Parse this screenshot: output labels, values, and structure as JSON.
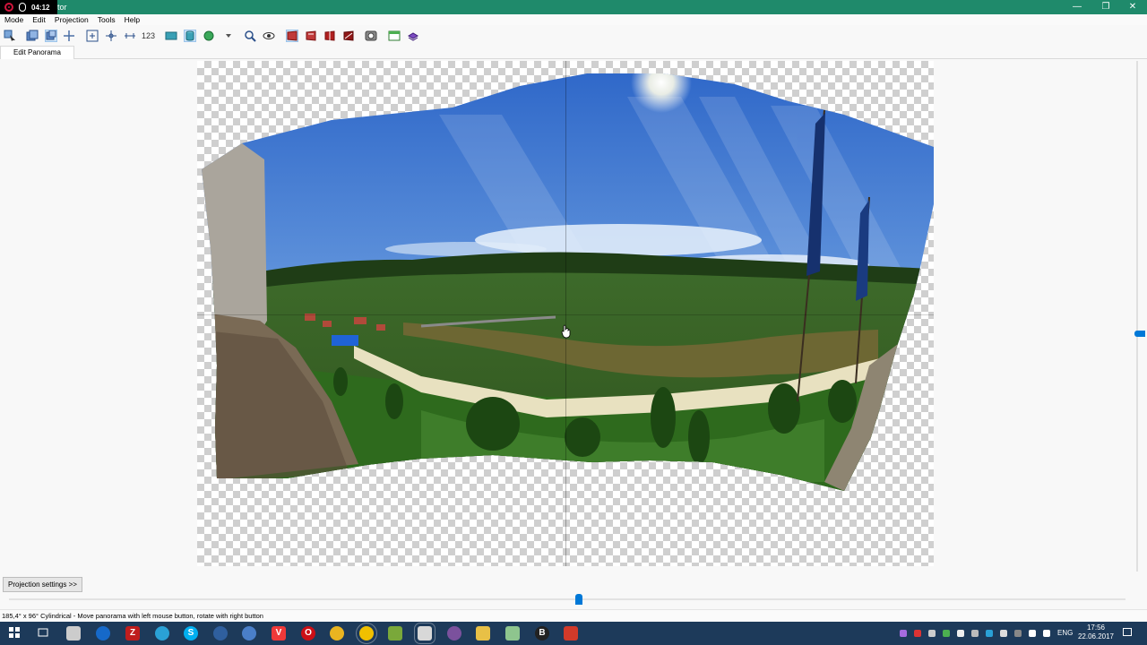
{
  "titlebar": {
    "recording_time": "04:12",
    "title_text": "tor",
    "minimize": "—",
    "maximize": "❐",
    "close": "✕"
  },
  "menu": [
    "Mode",
    "Edit",
    "Projection",
    "Tools",
    "Help"
  ],
  "toolbar": {
    "numbers_button": "123"
  },
  "tabs": [
    "Edit Panorama"
  ],
  "projection_button": "Projection settings >>",
  "zoom_slider": {
    "fraction": 0.51
  },
  "status": "185,4° x 96° Cylindrical - Move panorama with left mouse button, rotate with right button",
  "taskbar": {
    "pinned": [
      "start",
      "task-view",
      "notepad",
      "uplay",
      "filezilla",
      "telegram",
      "skype",
      "thunderbird",
      "nextcloud",
      "vivaldi",
      "opera",
      "chrome",
      "hugin-app",
      "plant-app",
      "file-manager",
      "viber",
      "folder",
      "notepadpp",
      "b-app",
      "app-red"
    ],
    "language": "ENG",
    "time": "17:56",
    "date": "22.06.2017"
  },
  "colors": {
    "titlebar": "#1f8a6b",
    "accent": "#0078d7",
    "taskbar": "#1d3a5a"
  }
}
